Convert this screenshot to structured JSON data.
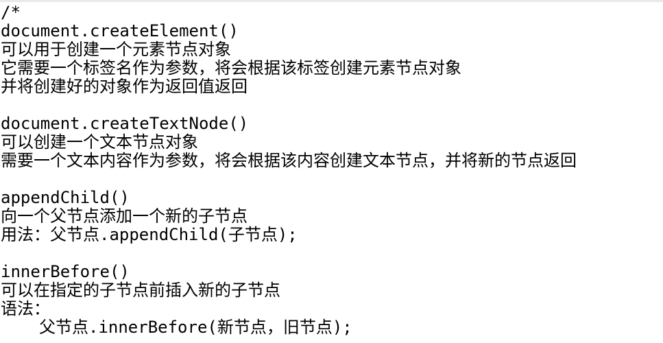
{
  "editor": {
    "comment_open": "/*",
    "createElement": {
      "signature": "document.createElement()",
      "desc1": "可以用于创建一个元素节点对象",
      "desc2": "它需要一个标签名作为参数，将会根据该标签创建元素节点对象",
      "desc3": "并将创建好的对象作为返回值返回"
    },
    "createTextNode": {
      "signature": "document.createTextNode()",
      "desc1": "可以创建一个文本节点对象",
      "desc2": "需要一个文本内容作为参数，将会根据该内容创建文本节点，并将新的节点返回"
    },
    "appendChild": {
      "signature": "appendChild()",
      "desc1": "向一个父节点添加一个新的子节点",
      "usage": "用法：父节点.appendChild(子节点);"
    },
    "innerBefore": {
      "signature": "innerBefore()",
      "desc1": "可以在指定的子节点前插入新的子节点",
      "syntax_label": "语法：",
      "syntax": "父节点.innerBefore(新节点，旧节点);"
    }
  }
}
